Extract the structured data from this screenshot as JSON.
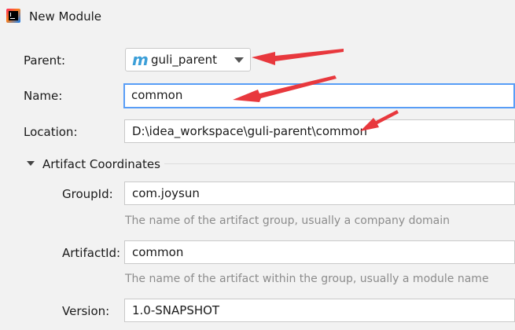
{
  "dialog": {
    "title": "New Module",
    "app_icon": "intellij-idea-icon"
  },
  "form": {
    "parent": {
      "label": "Parent:",
      "value": "guli_parent",
      "icon": "maven-module-icon"
    },
    "name": {
      "label": "Name:",
      "value": "common"
    },
    "location": {
      "label": "Location:",
      "value": "D:\\idea_workspace\\guli-parent\\common"
    }
  },
  "artifact_coordinates": {
    "title": "Artifact Coordinates",
    "group_id": {
      "label": "GroupId:",
      "value": "com.joysun",
      "hint": "The name of the artifact group, usually a company domain"
    },
    "artifact_id": {
      "label": "ArtifactId:",
      "value": "common",
      "hint": "The name of the artifact within the group, usually a module name"
    },
    "version": {
      "label": "Version:",
      "value": "1.0-SNAPSHOT"
    }
  },
  "colors": {
    "annotation_arrow": "#e8383d",
    "focus_border": "#589df6",
    "maven_icon": "#3c9fd8"
  }
}
